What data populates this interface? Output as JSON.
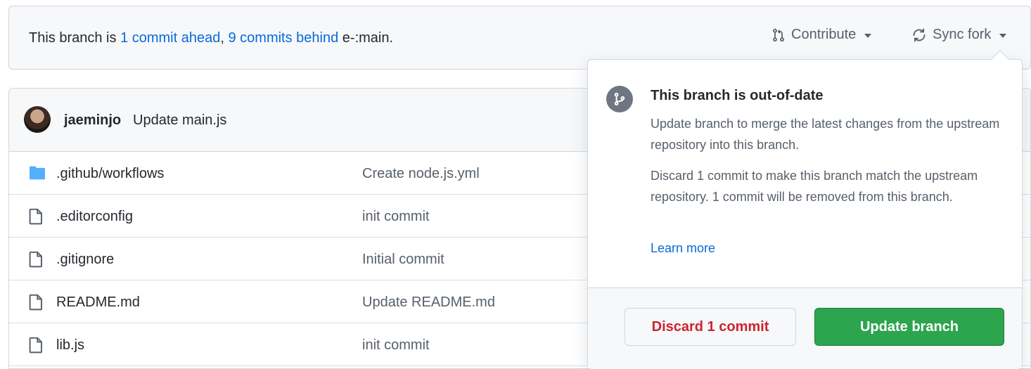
{
  "branch_bar": {
    "prefix": "This branch is ",
    "ahead": "1 commit ahead",
    "sep": ", ",
    "behind": "9 commits behind",
    "suffix": " e-:main.",
    "contribute_label": "Contribute",
    "sync_label": "Sync fork"
  },
  "latest_commit": {
    "author": "jaeminjo",
    "message": "Update main.js"
  },
  "files": [
    {
      "name": ".github/workflows",
      "type": "folder",
      "commit": "Create node.js.yml"
    },
    {
      "name": ".editorconfig",
      "type": "file",
      "commit": "init commit"
    },
    {
      "name": ".gitignore",
      "type": "file",
      "commit": "Initial commit"
    },
    {
      "name": "README.md",
      "type": "file",
      "commit": "Update README.md"
    },
    {
      "name": "lib.js",
      "type": "file",
      "commit": "init commit"
    }
  ],
  "popover": {
    "title": "This branch is out-of-date",
    "description": "Update branch to merge the latest changes from the upstream repository into this branch.",
    "discard_description": "Discard 1 commit to make this branch match the upstream repository. 1 commit will be removed from this branch.",
    "learn_more": "Learn more",
    "discard_button": "Discard 1 commit",
    "update_button": "Update branch"
  },
  "colors": {
    "link": "#0969da",
    "danger": "#cf222e",
    "primary": "#2da44e",
    "folder": "#54aeff"
  }
}
